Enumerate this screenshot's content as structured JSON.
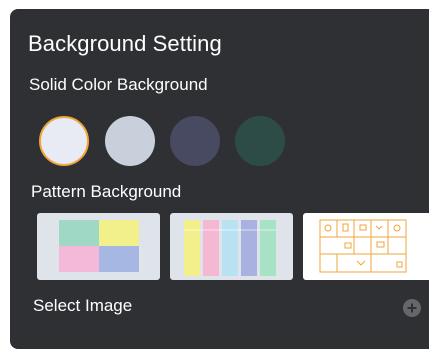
{
  "dialog": {
    "title": "Background Setting"
  },
  "solid": {
    "label": "Solid Color Background",
    "swatches": [
      {
        "name": "white",
        "color": "#e8ebf3",
        "selected": true
      },
      {
        "name": "light-gray",
        "color": "#c8d0dc",
        "selected": false
      },
      {
        "name": "slate",
        "color": "#474a60",
        "selected": false
      },
      {
        "name": "dark-green",
        "color": "#2d4c47",
        "selected": false
      }
    ],
    "selected_border_color": "#f0a53a"
  },
  "pattern": {
    "label": "Pattern Background",
    "tiles": [
      "color-blocks",
      "vertical-strips",
      "sticky-note-grid"
    ]
  },
  "select_image": {
    "label": "Select Image",
    "icon": "plus-icon"
  }
}
